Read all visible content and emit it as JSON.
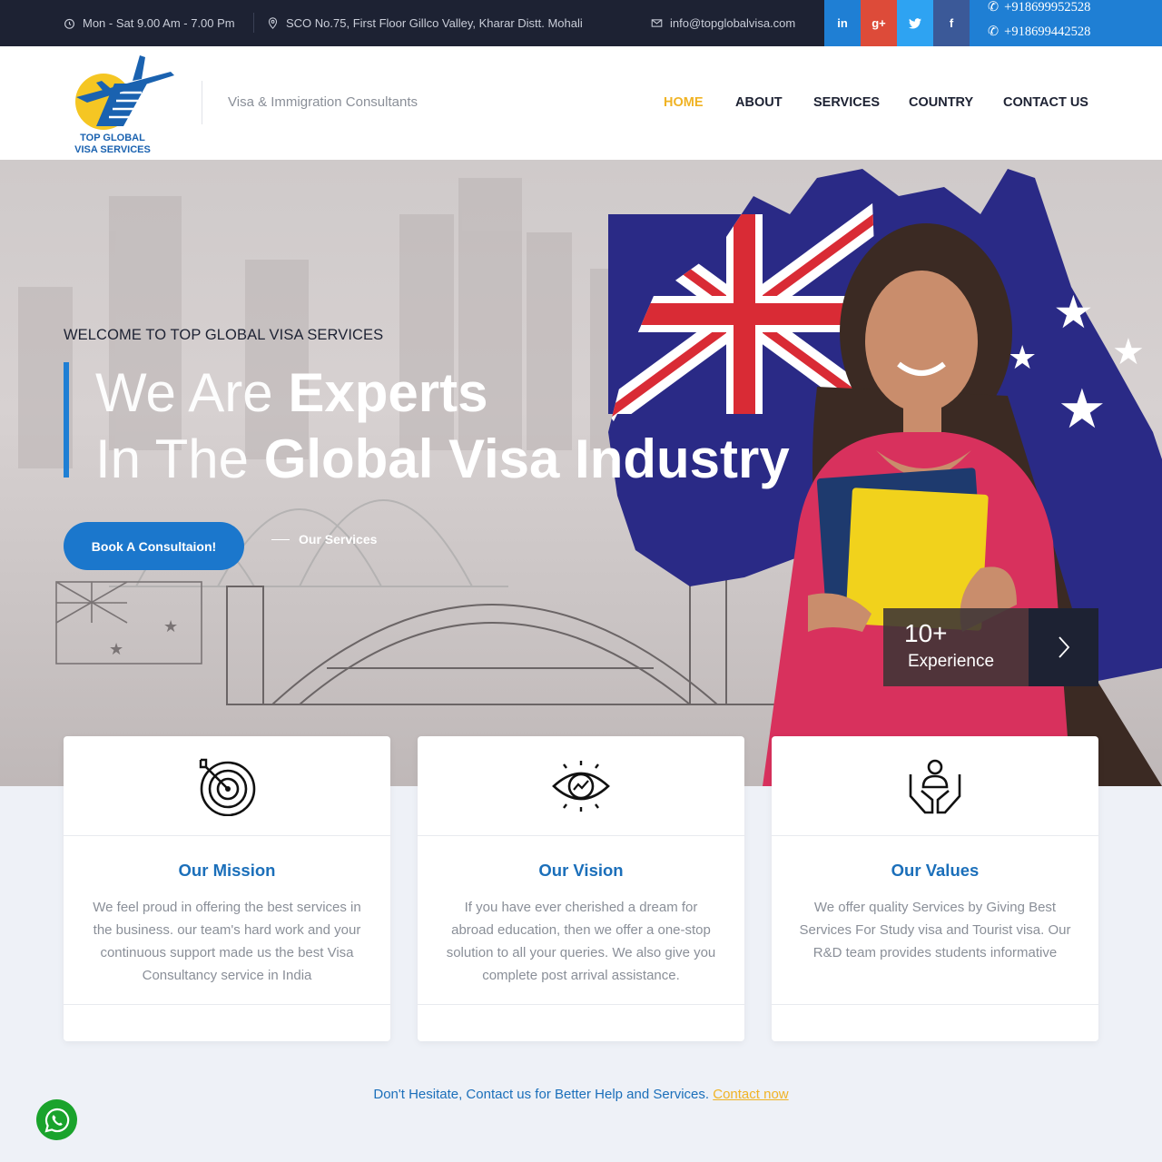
{
  "topbar": {
    "hours": "Mon - Sat 9.00 Am - 7.00 Pm",
    "address": "SCO No.75, First Floor Gillco Valley, Kharar Distt. Mohali",
    "email": "info@topglobalvisa.com",
    "social": [
      {
        "icon": "linkedin-icon",
        "label": "in",
        "color": "#1f7fd4"
      },
      {
        "icon": "google-plus-icon",
        "label": "g+",
        "color": "#dd4b39"
      },
      {
        "icon": "twitter-icon",
        "label": "t",
        "color": "#2ea3f2"
      },
      {
        "icon": "facebook-icon",
        "label": "f",
        "color": "#3b5998"
      }
    ],
    "phones": [
      "+918699952528",
      "+918699442528"
    ]
  },
  "header": {
    "logo_text_line1": "TOP GLOBAL",
    "logo_text_line2": "VISA SERVICES",
    "tagline": "Visa & Immigration Consultants",
    "nav": [
      "HOME",
      "ABOUT",
      "SERVICES",
      "COUNTRY",
      "CONTACT US"
    ],
    "active_nav": "HOME"
  },
  "hero": {
    "kicker": "WELCOME TO TOP GLOBAL VISA SERVICES",
    "line1_thin": "We Are ",
    "line1_bold": "Experts",
    "line2_thin": "In The ",
    "line2_bold": "Global Visa Industry",
    "book_button": "Book A Consultaion!",
    "services_link": "Our Services",
    "experience_number": "10+",
    "experience_label": "Experience"
  },
  "cards": [
    {
      "icon": "target-icon",
      "title": "Our Mission",
      "text": "We feel proud in offering the best services in the business. our team's hard work and your continuous support made us the best Visa Consultancy service in India"
    },
    {
      "icon": "eye-icon",
      "title": "Our Vision",
      "text": "If you have ever cherished a dream for abroad education, then we offer a one-stop solution to all your queries. We also give you complete post arrival assistance."
    },
    {
      "icon": "hands-person-icon",
      "title": "Our Values",
      "text": "We offer quality Services by Giving Best Services For Study visa and Tourist visa. Our R&D team provides students informative"
    }
  ],
  "cta": {
    "text": "Don't Hesitate, Contact us for Better Help and Services. ",
    "link": "Contact now"
  },
  "colors": {
    "primary": "#1f7fd4",
    "accent": "#f0b324",
    "dark": "#1d2233"
  }
}
